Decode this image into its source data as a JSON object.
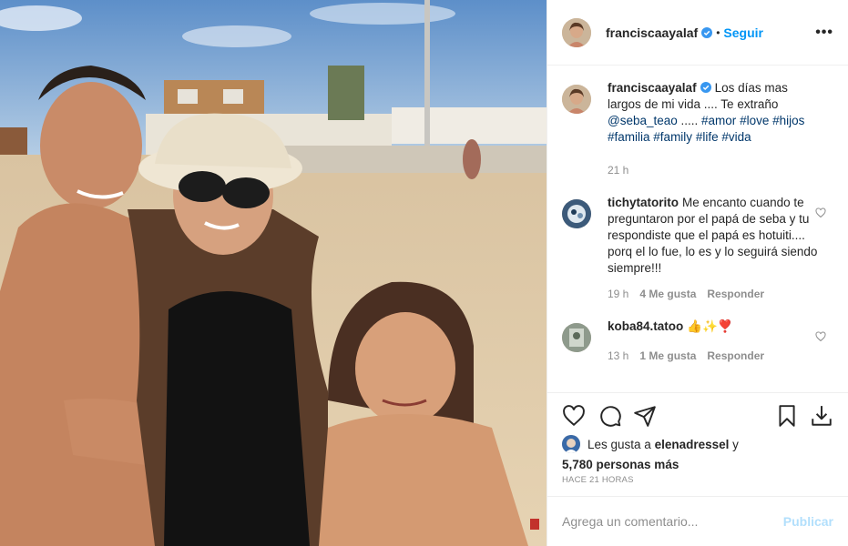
{
  "post": {
    "author": "franciscaayalaf",
    "follow_label": "Seguir",
    "dot": "•",
    "more_label": "•••"
  },
  "caption": {
    "user": "franciscaayalaf",
    "text_a": "Los días mas largos de mi vida .... Te extraño ",
    "mention": "@seba_teao",
    "text_b": " ..... ",
    "hashtags": [
      "#amor",
      "#love",
      "#hijos",
      "#familia",
      "#family",
      "#life",
      "#vida"
    ],
    "time": "21 h"
  },
  "comments": [
    {
      "user": "tichytatorito",
      "text": "Me encanto cuando te preguntaron por el papá de seba y tu respondiste que el papá es hotuiti.... porq el lo fue, lo es y lo seguirá siendo siempre!!!",
      "time": "19 h",
      "likes": "4 Me gusta",
      "reply": "Responder"
    },
    {
      "user": "koba84.tatoo",
      "text": "👍✨❣️",
      "time": "13 h",
      "likes": "1 Me gusta",
      "reply": "Responder"
    }
  ],
  "likes": {
    "prefix": "Les gusta a ",
    "user": "elenadressel",
    "suffix": " y",
    "count": "5,780 personas más"
  },
  "timestamp": "HACE 21 HORAS",
  "add_comment": {
    "placeholder": "Agrega un comentario...",
    "post_label": "Publicar"
  },
  "colors": {
    "link_blue": "#0095f6",
    "tag_blue": "#00376b",
    "muted": "#8e8e8e",
    "verified": "#3897f0"
  },
  "icons": [
    "heart-icon",
    "comment-icon",
    "share-icon",
    "save-icon",
    "download-icon",
    "verified-icon",
    "more-icon"
  ]
}
